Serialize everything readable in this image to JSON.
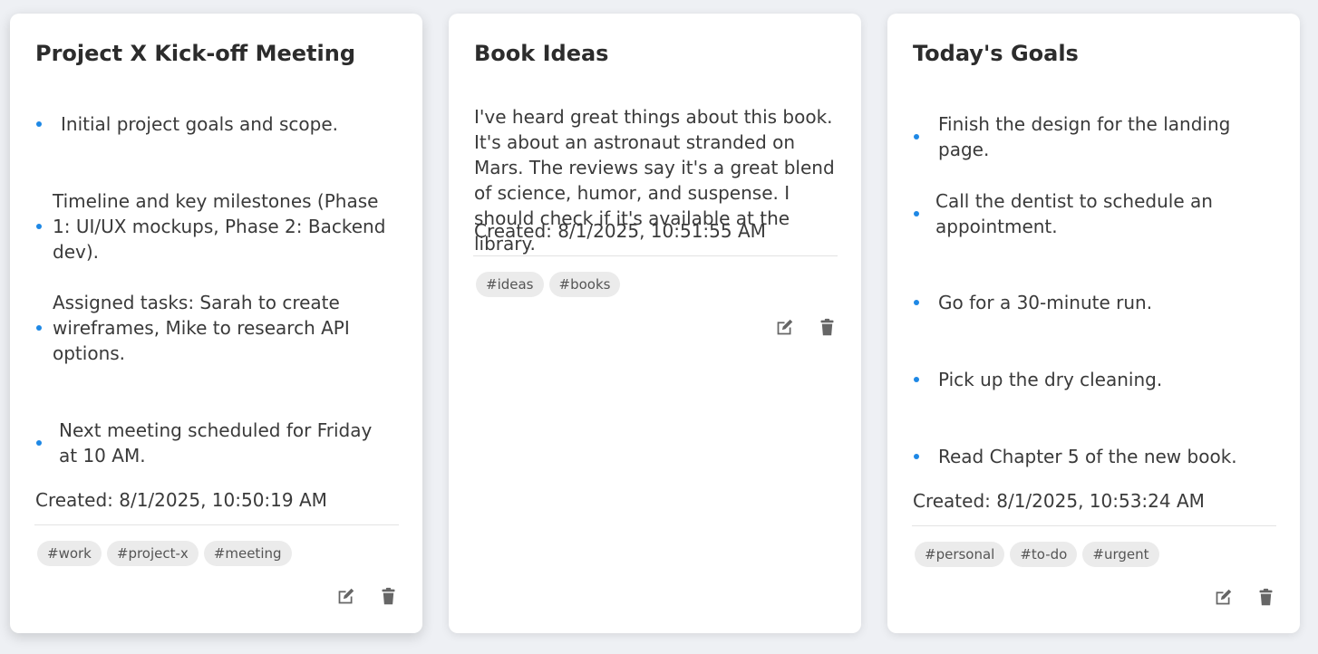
{
  "notes": [
    {
      "title": "Project X Kick-off Meeting",
      "bullets": [
        "Initial project goals and scope.",
        "Timeline and key milestones (Phase 1: UI/UX mockups, Phase 2: Backend dev).",
        "Assigned tasks: Sarah to create wireframes, Mike to research API options.",
        "Next meeting scheduled for Friday at 10 AM."
      ],
      "created": "Created: 8/1/2025, 10:50:19 AM",
      "tags": [
        "#work",
        "#project-x",
        "#meeting"
      ]
    },
    {
      "title": "Book Ideas",
      "body": "I've heard great things about this book. It's about an astronaut stranded on Mars. The reviews say it's a great blend of science, humor, and suspense. I should check if it's available at the library.",
      "created": "Created: 8/1/2025, 10:51:55 AM",
      "tags": [
        "#ideas",
        "#books"
      ]
    },
    {
      "title": "Today's Goals",
      "bullets": [
        "Finish the design for the landing page.",
        "Call the dentist to schedule an appointment.",
        "Go for a 30-minute run.",
        "Pick up the dry cleaning.",
        "Read Chapter 5 of the new book."
      ],
      "created": "Created: 8/1/2025, 10:53:24 AM",
      "tags": [
        "#personal",
        "#to-do",
        "#urgent"
      ]
    }
  ],
  "icons": {
    "edit": "edit-icon",
    "delete": "trash-icon"
  },
  "colors": {
    "background": "#eef0f4",
    "card": "#ffffff",
    "bullet": "#1e88e5",
    "tag_bg": "#ebebeb",
    "icon": "#666666"
  }
}
